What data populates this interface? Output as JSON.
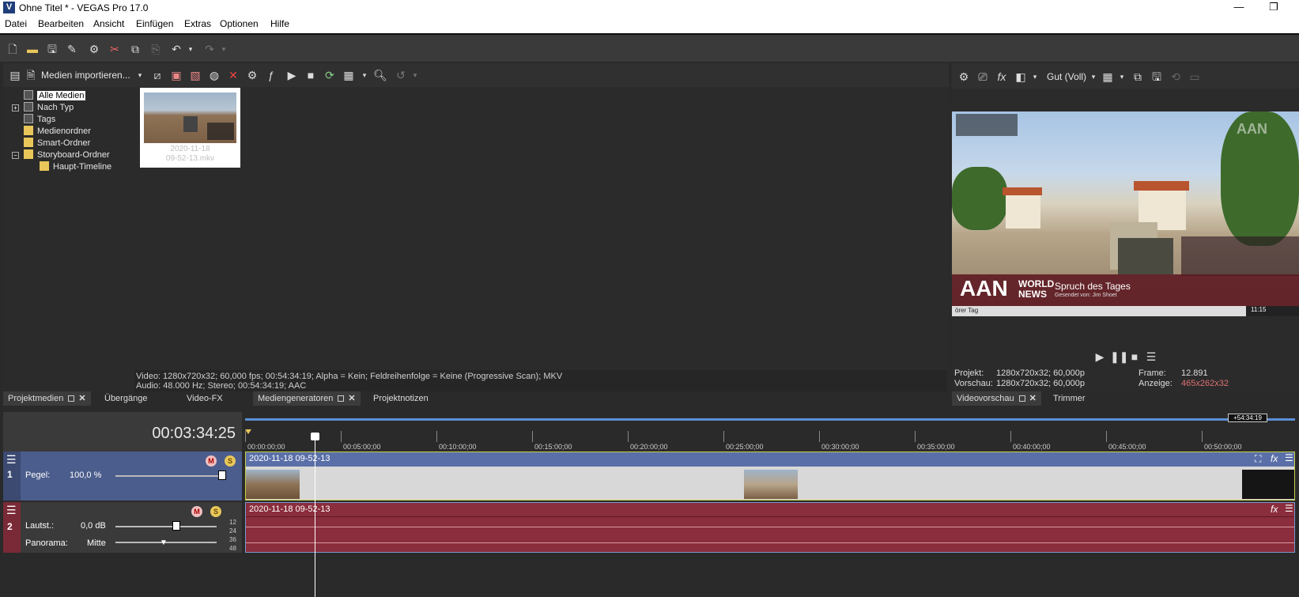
{
  "window": {
    "title": "Ohne Titel * - VEGAS Pro 17.0",
    "app_icon_glyph": "V",
    "minimize_glyph": "—",
    "maximize_glyph": "❐"
  },
  "menu": [
    {
      "label": "Datei",
      "accel": "D"
    },
    {
      "label": "Bearbeiten",
      "accel": "B"
    },
    {
      "label": "Ansicht",
      "accel": "A"
    },
    {
      "label": "Einfügen",
      "accel": "E"
    },
    {
      "label": "Extras",
      "accel": "x"
    },
    {
      "label": "Optionen",
      "accel": "O"
    },
    {
      "label": "Hilfe",
      "accel": "H"
    }
  ],
  "media": {
    "import_label": "Medien importieren...",
    "tree": [
      {
        "label": "Alle Medien",
        "selected": true
      },
      {
        "label": "Nach Typ"
      },
      {
        "label": "Tags"
      },
      {
        "label": "Medienordner"
      },
      {
        "label": "Smart-Ordner"
      },
      {
        "label": "Storyboard-Ordner"
      },
      {
        "label": "Haupt-Timeline"
      }
    ],
    "thumb_line1": "2020-11-18",
    "thumb_line2": "09-52-13.mkv",
    "info_video": "Video: 1280x720x32; 60,000 fps; 00:54:34:19; Alpha = Kein; Feldreihenfolge = Keine (Progressive Scan); MKV",
    "info_audio": "Audio: 48.000 Hz; Stereo; 00:54:34:19; AAC"
  },
  "bottom_tabs": [
    "Projektmedien",
    "Übergänge",
    "Video-FX",
    "Mediengeneratoren",
    "Projektnotizen"
  ],
  "preview": {
    "quality": "Gut (Voll)",
    "overlay_brand": "AAN",
    "overlay_world": "WORLD",
    "overlay_news": "NEWS",
    "overlay_headline": "Spruch des Tages",
    "overlay_sub": "Gesendet von: Jim Shoet",
    "overlay_ticker": "örer Tag",
    "overlay_time": "11:15",
    "overlay_corner": "AAN",
    "project_label": "Projekt:",
    "project_value": "1280x720x32; 60,000p",
    "preview_label": "Vorschau:",
    "preview_value": "1280x720x32; 60,000p",
    "frame_label": "Frame:",
    "frame_value": "12.891",
    "display_label": "Anzeige:",
    "display_value": "465x262x32",
    "tabs": [
      "Videovorschau",
      "Trimmer"
    ]
  },
  "timeline": {
    "timecode": "00:03:34:25",
    "end_marker": "+54:34:19",
    "ruler": [
      "00:00:00;00",
      "00:05:00;00",
      "00:10:00;00",
      "00:15:00;00",
      "00:20:00;00",
      "00:25:00;00",
      "00:30:00;00",
      "00:35:00;00",
      "00:40:00;00",
      "00:45:00;00",
      "00:50:00;00"
    ],
    "video_track": {
      "number": "1",
      "level_label": "Pegel:",
      "level_value": "100,0 %",
      "clip_name": "2020-11-18 09-52-13"
    },
    "audio_track": {
      "number": "2",
      "volume_label": "Lautst.:",
      "volume_value": "0,0 dB",
      "pan_label": "Panorama:",
      "pan_value": "Mitte",
      "clip_name": "2020-11-18 09-52-13",
      "meter_marks": [
        "12",
        "24",
        "36",
        "48"
      ]
    }
  },
  "colors": {
    "video_clip": "#5a6fa8",
    "audio_clip": "#8a2d3c",
    "accent": "#e8c65a"
  }
}
